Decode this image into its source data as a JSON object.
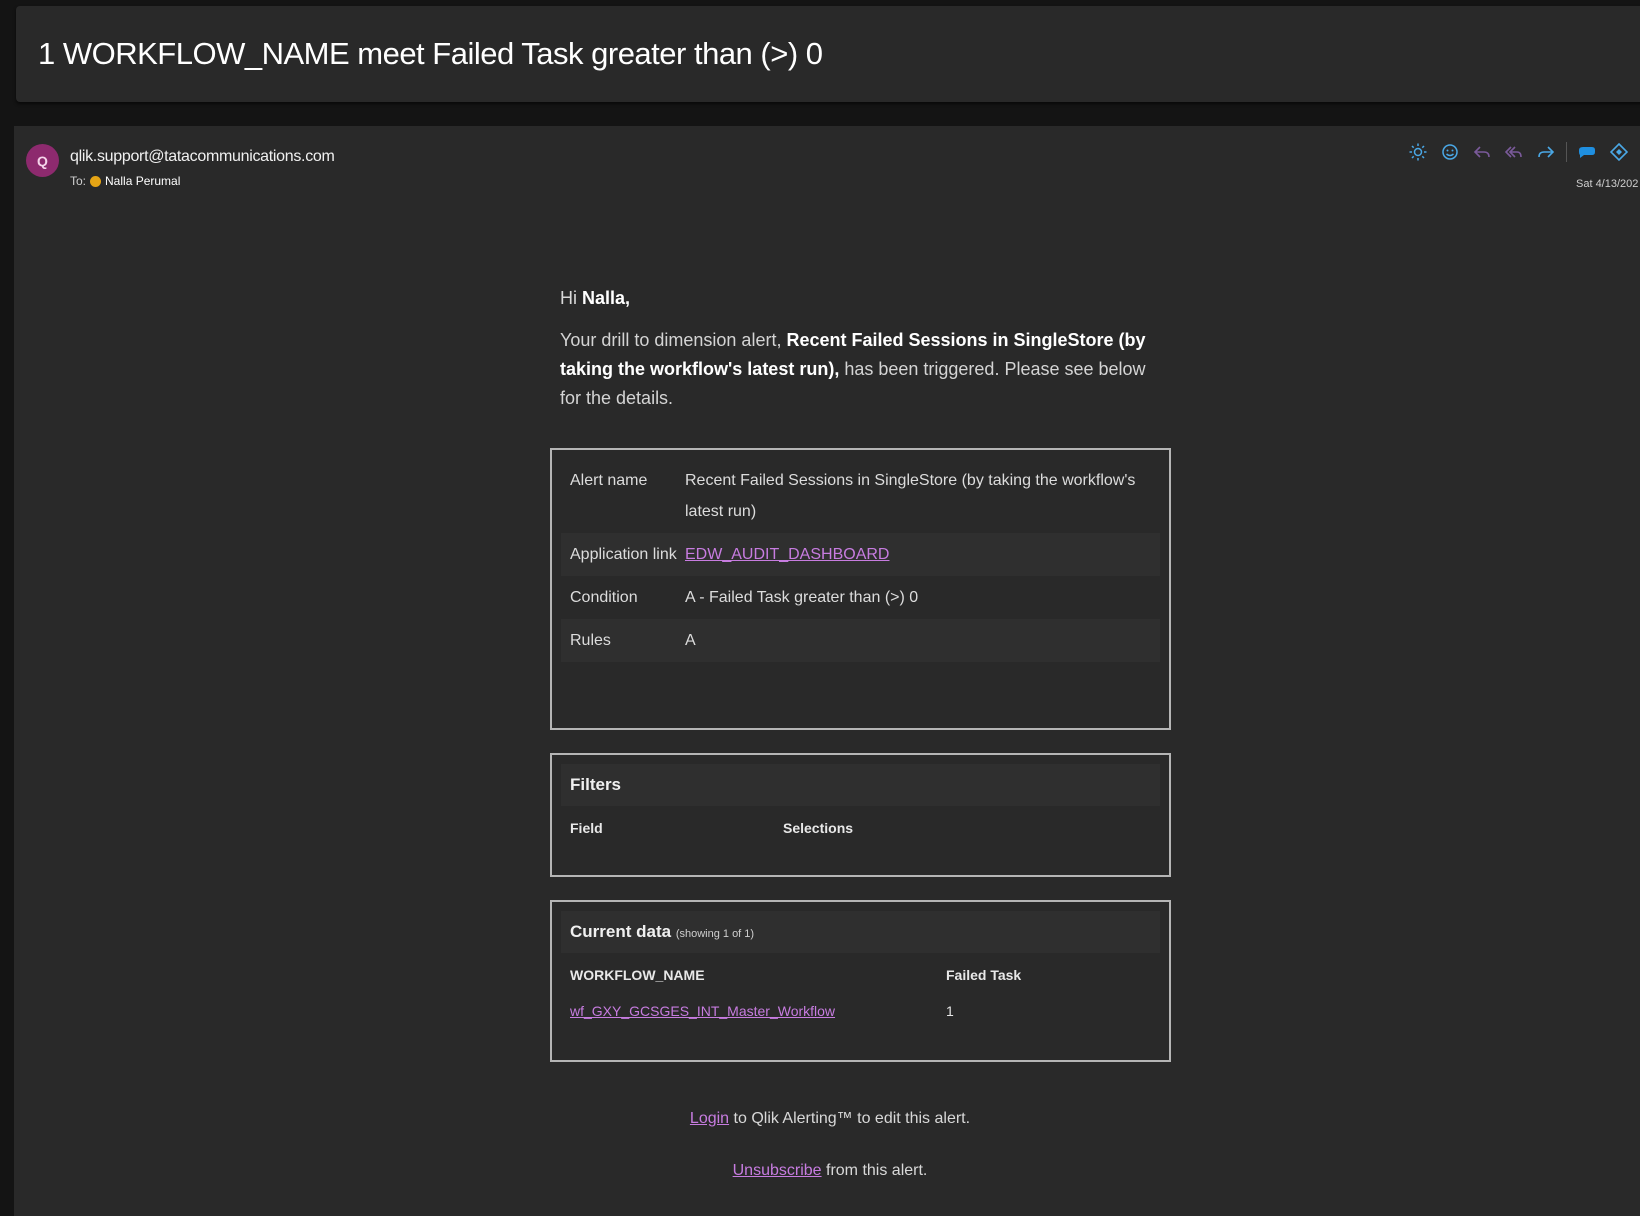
{
  "subject": "1 WORKFLOW_NAME meet Failed Task greater than (>) 0",
  "header": {
    "avatar_initial": "Q",
    "sender": "qlik.support@tatacommunications.com",
    "to_label": "To:",
    "recipient": "Nalla Perumal",
    "date": "Sat 4/13/202",
    "toolbar_icons": [
      "sun-icon",
      "emoji-icon",
      "reply-icon",
      "reply-all-icon",
      "forward-icon",
      "teams-icon",
      "loop-icon",
      "more-icon"
    ],
    "colors": {
      "toolbar_icon": "#4aa8e6",
      "avatar": "#8d2a6e",
      "status_dot": "#e5a415"
    }
  },
  "body": {
    "greeting_prefix": "Hi ",
    "greeting_name": "Nalla,",
    "intro_prefix": "Your drill to dimension alert, ",
    "intro_bold": "Recent Failed Sessions in SingleStore (by taking the workflow's latest run),",
    "intro_suffix": " has been triggered. Please see below for the details.",
    "alert_table": [
      {
        "label": "Alert name",
        "value": "Recent Failed Sessions in SingleStore (by taking the workflow's latest run)"
      },
      {
        "label": "Application link",
        "value": "EDW_AUDIT_DASHBOARD"
      },
      {
        "label": "Condition",
        "value": "A - Failed Task greater than (>) 0"
      },
      {
        "label": "Rules",
        "value": "A"
      }
    ],
    "filters": {
      "title": "Filters",
      "col_field": "Field",
      "col_selections": "Selections"
    },
    "current_data": {
      "title": "Current data",
      "showing": "(showing 1 of 1)",
      "columns": [
        "WORKFLOW_NAME",
        "Failed Task"
      ],
      "rows": [
        [
          "wf_GXY_GCSGES_INT_Master_Workflow",
          "1"
        ]
      ]
    },
    "footer": {
      "login_link": "Login",
      "login_text": " to Qlik Alerting™ to edit this alert.",
      "unsub_link": "Unsubscribe",
      "unsub_text": " from this alert."
    },
    "colors": {
      "link": "#c77ce0",
      "border": "#b5b5b5"
    }
  }
}
